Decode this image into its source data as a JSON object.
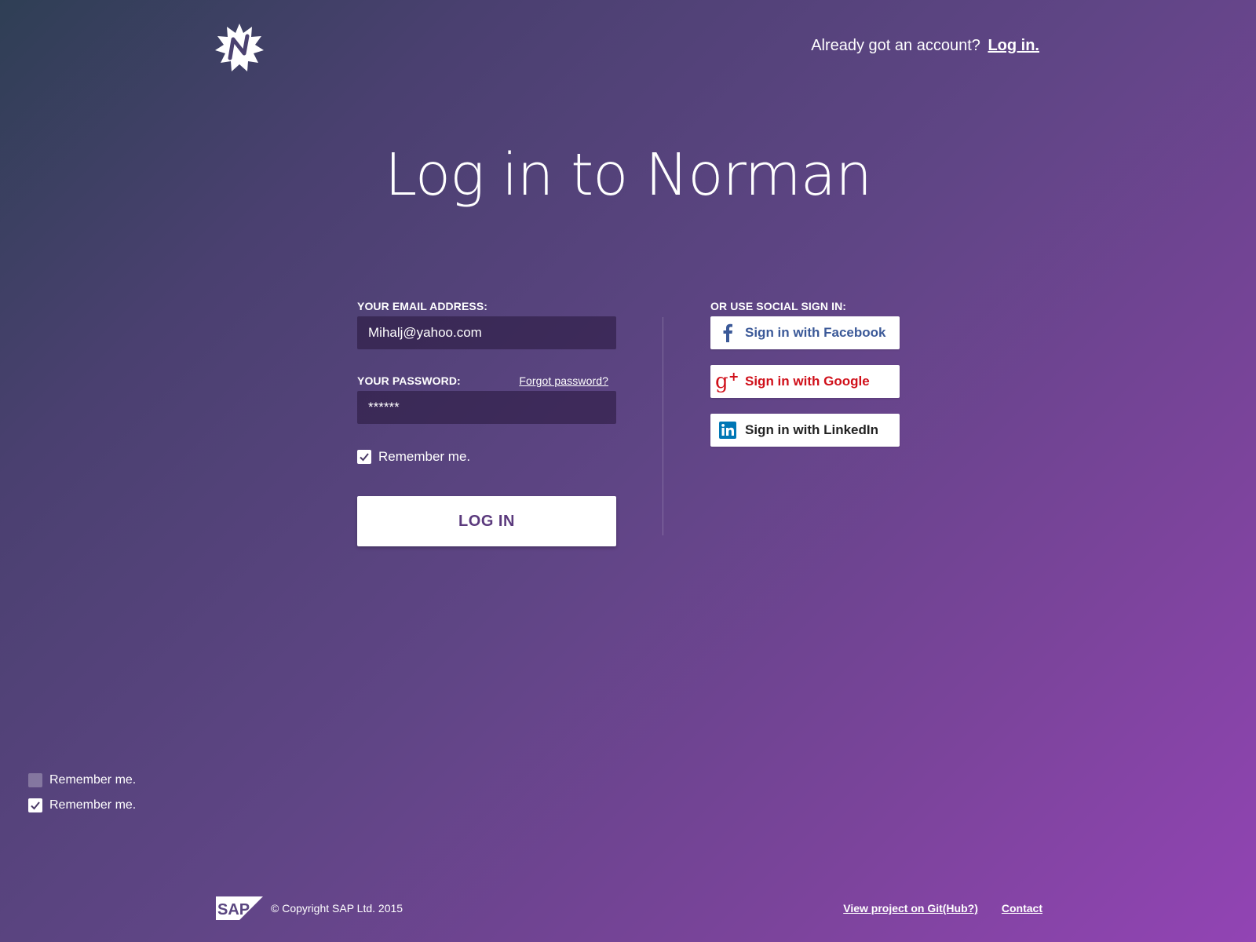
{
  "brand": {
    "logo_icon": "norman-starburst-icon"
  },
  "header": {
    "account_prompt": "Already got an account?",
    "login_link": "Log in."
  },
  "page": {
    "title": "Log in to Norman"
  },
  "form": {
    "email_label": "YOUR EMAIL ADDRESS:",
    "email_value": "Mihalj@yahoo.com",
    "password_label": "YOUR PASSWORD:",
    "forgot_link": "Forgot password?",
    "password_value": "******",
    "remember_label": "Remember me.",
    "remember_checked": true,
    "login_button": "LOG IN"
  },
  "social": {
    "heading": "OR USE SOCIAL SIGN IN:",
    "buttons": [
      {
        "label": "Sign in with Facebook",
        "icon": "facebook-icon",
        "color": "#3b5998"
      },
      {
        "label": "Sign in with Google",
        "icon": "google-plus-icon",
        "color": "#d0101a"
      },
      {
        "label": "Sign in with LinkedIn",
        "icon": "linkedin-icon",
        "color": "#0077b5"
      }
    ]
  },
  "checkbox_samples": [
    {
      "label": "Remember me.",
      "checked": false
    },
    {
      "label": "Remember me.",
      "checked": true
    }
  ],
  "footer": {
    "sap_logo": "SAP",
    "copyright": "© Copyright SAP Ltd. 2015",
    "links": [
      "View project on Git(Hub?)",
      "Contact"
    ]
  },
  "colors": {
    "gradient_start": "#2f3f55",
    "gradient_end": "#9244b4",
    "button_text": "#5b3a7d",
    "input_bg": "#3a2852"
  }
}
